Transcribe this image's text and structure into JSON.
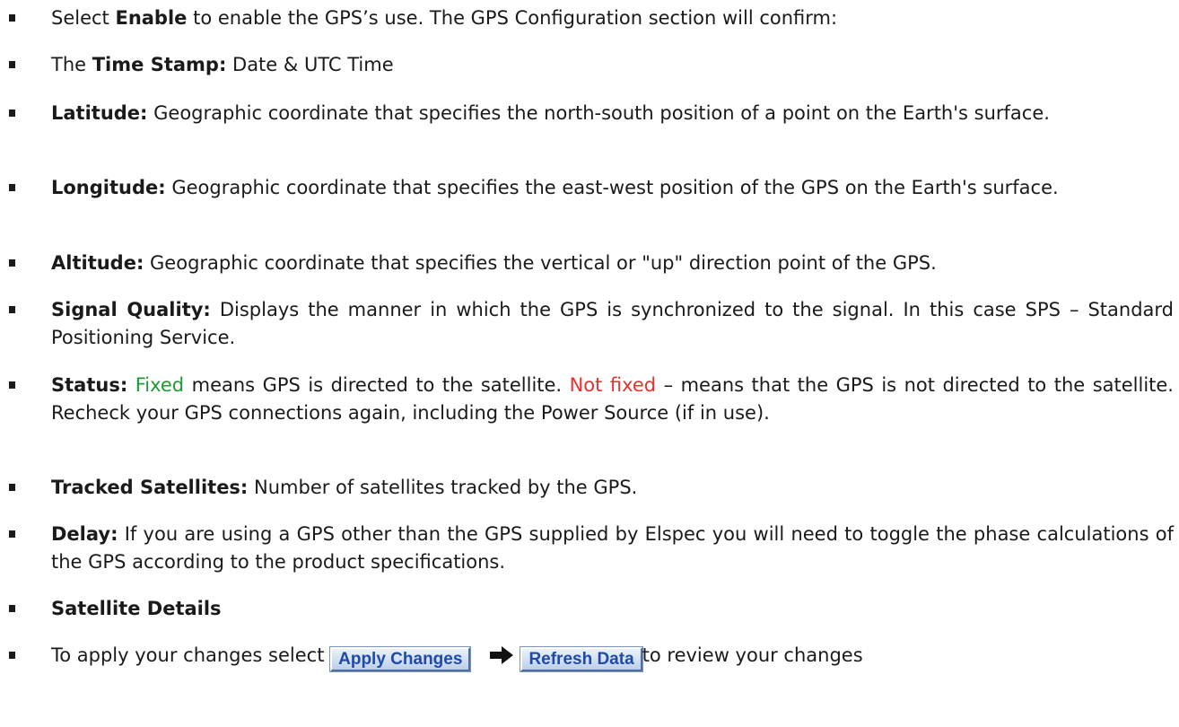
{
  "items": [
    {
      "a": "Select ",
      "b": "Enable",
      "c": " to enable the GPS’s use.  The GPS Configuration section will confirm:"
    },
    {
      "a": "The ",
      "b": "Time Stamp:",
      "c": " Date & UTC Time"
    },
    {
      "b": "Latitude:",
      "c": " Geographic coordinate that specifies the north-south position of a point on the Earth's surface."
    },
    {
      "b": "Longitude:",
      "c": " Geographic coordinate that specifies the east-west position of the GPS on the Earth's surface."
    },
    {
      "b": "Altitude:",
      "c": " Geographic coordinate that specifies the vertical or \"up\" direction point of the GPS."
    },
    {
      "b": "Signal Quality:",
      "c": " Displays the manner in which the GPS is synchronized to the signal. In this case SPS – Standard Positioning Service."
    },
    {
      "b": "Status:",
      "fixed": "Fixed",
      "c": " means GPS is directed to the satellite. ",
      "not_fixed": "Not fixed",
      "d": " – means that the GPS is not directed to the satellite. Recheck your GPS connections again, including the Power Source (if in use)."
    },
    {
      "b": "Tracked Satellites:",
      "c": " Number of satellites tracked by the GPS."
    },
    {
      "b": "Delay:",
      "c": " If you are using a GPS other than the GPS supplied by Elspec you will need to toggle the phase calculations of the GPS according to the product specifications."
    },
    {
      "b": "Satellite Details"
    },
    {
      "a": "To apply your changes select ",
      "c": "to review your changes"
    }
  ],
  "buttons": {
    "apply": "Apply Changes",
    "refresh": "Refresh Data"
  },
  "icons": {
    "arrow": "right-arrow-icon"
  }
}
